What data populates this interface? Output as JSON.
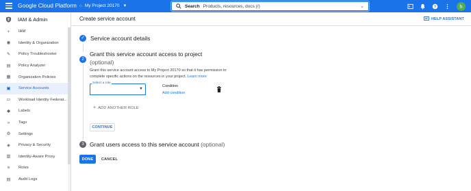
{
  "topbar": {
    "brand": "Google Cloud Platform",
    "project": "My Project 20170",
    "search_label": "Search",
    "search_placeholder": "Products, resources, docs (/)",
    "avatar_letter": "h"
  },
  "sidebar": {
    "title": "IAM & Admin",
    "items": [
      {
        "label": "IAM",
        "icon": "person-add-icon"
      },
      {
        "label": "Identity & Organization",
        "icon": "identity-icon"
      },
      {
        "label": "Policy Troubleshooter",
        "icon": "wrench-icon"
      },
      {
        "label": "Policy Analyzer",
        "icon": "analyzer-icon"
      },
      {
        "label": "Organization Policies",
        "icon": "org-policy-icon"
      },
      {
        "label": "Service Accounts",
        "icon": "service-account-icon",
        "active": true
      },
      {
        "label": "Workload Identity Federat...",
        "icon": "workload-icon"
      },
      {
        "label": "Labels",
        "icon": "label-icon"
      },
      {
        "label": "Tags",
        "icon": "tag-icon"
      },
      {
        "label": "Settings",
        "icon": "gear-icon"
      },
      {
        "label": "Privacy & Security",
        "icon": "shield-icon"
      },
      {
        "label": "Identity-Aware Proxy",
        "icon": "proxy-icon"
      },
      {
        "label": "Roles",
        "icon": "roles-icon"
      },
      {
        "label": "Audit Logs",
        "icon": "audit-icon"
      }
    ]
  },
  "header": {
    "title": "Create service account",
    "help": "HELP ASSISTANT"
  },
  "step1": {
    "title": "Service account details"
  },
  "step2": {
    "number": "2",
    "title": "Grant this service account access to project",
    "optional": "(optional)",
    "description": "Grant this service account access to My Project 20170 so that it has permission to complete specific actions on the resources in your project.",
    "learn_more": "Learn more",
    "role_label": "Select a role",
    "condition_label": "Condition",
    "add_condition": "Add condition",
    "add_another_role": "ADD ANOTHER ROLE",
    "continue": "CONTINUE"
  },
  "step3": {
    "number": "3",
    "title": "Grant users access to this service account",
    "optional": "(optional)"
  },
  "actions": {
    "done": "DONE",
    "cancel": "CANCEL"
  },
  "colors": {
    "primary": "#1a73e8",
    "active_bg": "#e8f0fe"
  }
}
